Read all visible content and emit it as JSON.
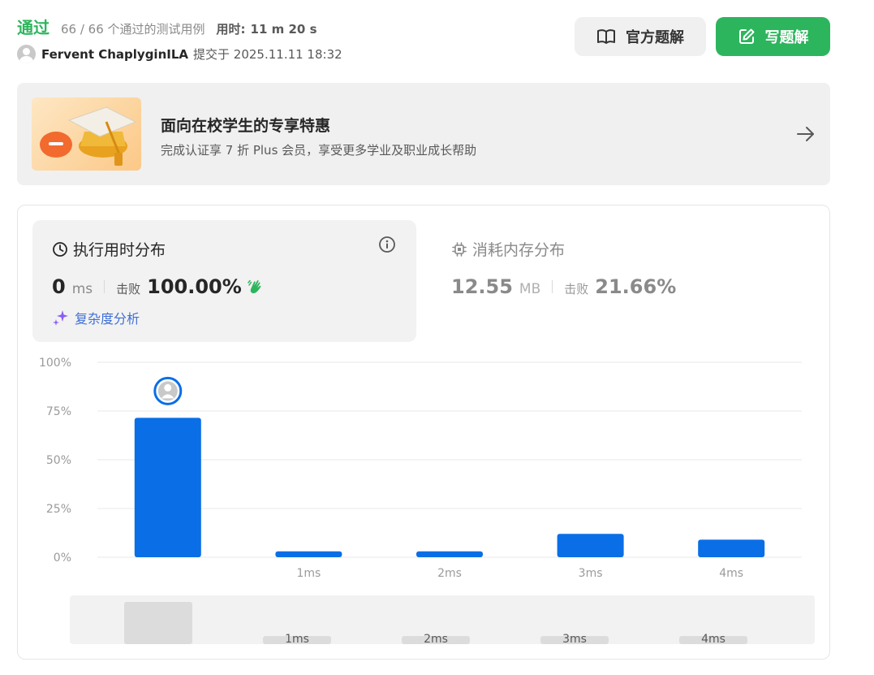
{
  "result": {
    "status": "通过",
    "testcases": "66 / 66 个通过的测试用例",
    "time_label": "用时:",
    "time_value": "11 m 20 s",
    "submitter": "Fervent ChaplyginILA",
    "submitted_text": "提交于 2025.11.11 18:32"
  },
  "buttons": {
    "official_solution": "官方题解",
    "write_solution": "写题解"
  },
  "promo": {
    "title": "面向在校学生的专享特惠",
    "subtitle": "完成认证享 7 折 Plus 会员，享受更多学业及职业成长帮助"
  },
  "runtime": {
    "title": "执行用时分布",
    "value": "0",
    "unit": "ms",
    "beat_label": "击败",
    "beat_value": "100.00%",
    "complexity_link": "复杂度分析"
  },
  "memory": {
    "title": "消耗内存分布",
    "value": "12.55",
    "unit": "MB",
    "beat_label": "击败",
    "beat_value": "21.66%"
  },
  "colors": {
    "accent_green": "#2db55d",
    "bar_blue": "#0a6ee6",
    "link_blue": "#3e6fd6"
  },
  "icons": {
    "solution": "book-open-icon",
    "write": "edit-icon",
    "promo_arrow": "arrow-right-icon",
    "runtime": "clock-icon",
    "info": "info-icon",
    "memory": "chip-icon",
    "complexity": "sparkle-icon",
    "beat": "clap-icon"
  },
  "chart_data": {
    "type": "bar",
    "categories": [
      "0ms",
      "1ms",
      "2ms",
      "3ms",
      "4ms"
    ],
    "tick_labels": [
      "",
      "1ms",
      "2ms",
      "3ms",
      "4ms"
    ],
    "values": [
      71.5,
      3,
      3,
      12,
      9
    ],
    "y_ticks": [
      "100%",
      "75%",
      "50%",
      "25%",
      "0%"
    ],
    "ylim": [
      0,
      100
    ],
    "highlight_index": 0,
    "grid": true
  },
  "scroller": {
    "labels": [
      "1ms",
      "2ms",
      "3ms",
      "4ms"
    ]
  }
}
